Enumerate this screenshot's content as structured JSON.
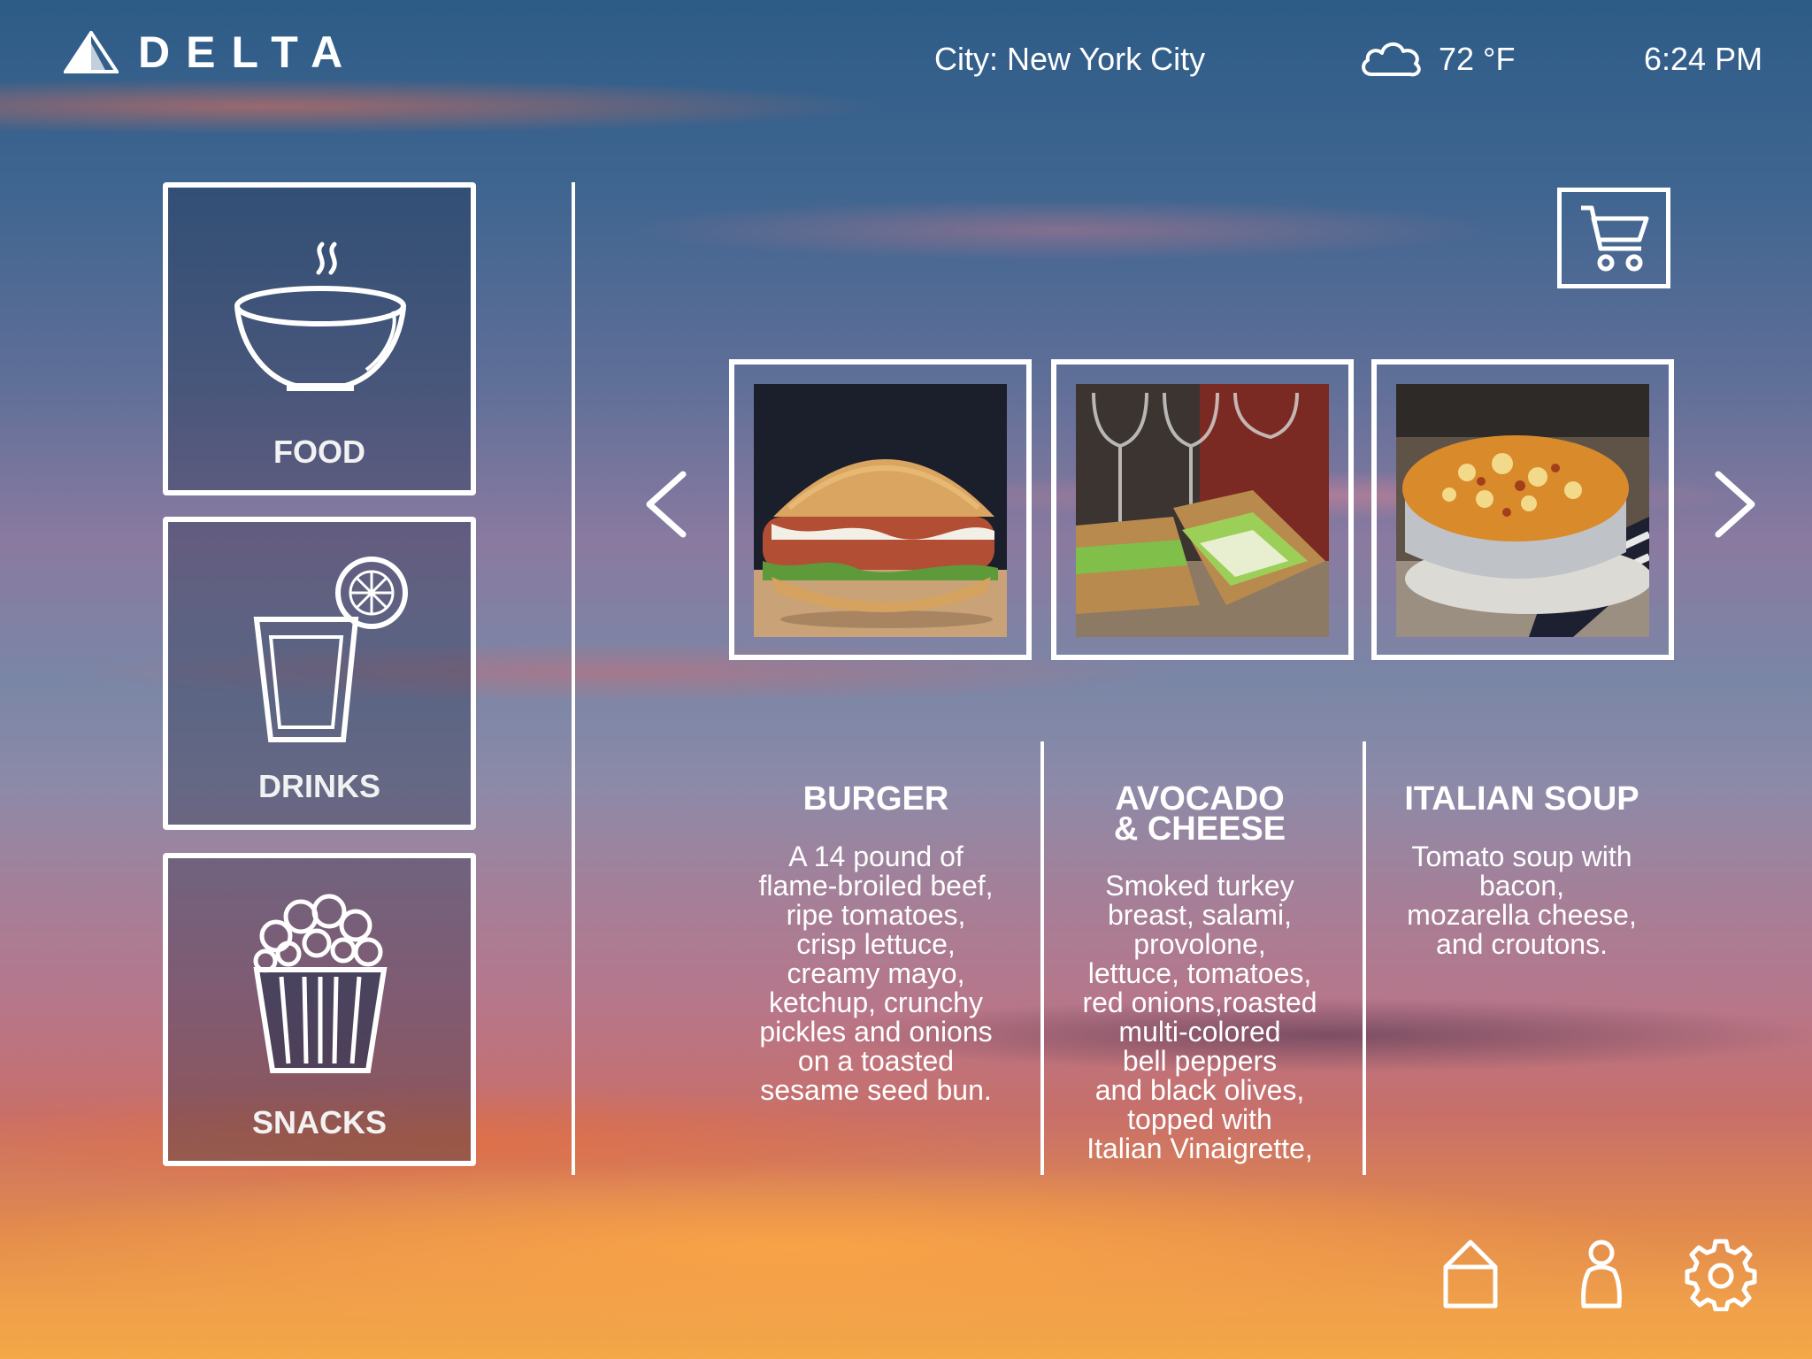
{
  "header": {
    "brand": "DELTA",
    "city": "City: New York City",
    "temperature": "72 °F",
    "time": "6:24 PM",
    "weather_icon": "cloud-icon"
  },
  "categories": [
    {
      "label": "FOOD",
      "icon": "soup-bowl-icon"
    },
    {
      "label": "DRINKS",
      "icon": "drink-glass-icon"
    },
    {
      "label": "SNACKS",
      "icon": "popcorn-icon"
    }
  ],
  "menu_items": [
    {
      "name": "BURGER",
      "description": "A 14 pound of\nflame-broiled beef,\nripe tomatoes,\ncrisp lettuce,\ncreamy mayo,\nketchup, crunchy\npickles and onions\non a toasted\nsesame seed bun."
    },
    {
      "name": "AVOCADO\n& CHEESE",
      "description": "Smoked turkey\nbreast, salami,\nprovolone,\nlettuce, tomatoes,\nred onions,roasted\nmulti-colored\nbell peppers\nand black olives,\ntopped with\nItalian Vinaigrette,"
    },
    {
      "name": "ITALIAN SOUP",
      "description": "Tomato soup with\nbacon,\nmozarella cheese,\nand croutons."
    }
  ],
  "icons": {
    "cart": "shopping-cart-icon",
    "prev": "chevron-left-icon",
    "next": "chevron-right-icon",
    "home": "home-icon",
    "profile": "person-icon",
    "settings": "gear-icon"
  }
}
